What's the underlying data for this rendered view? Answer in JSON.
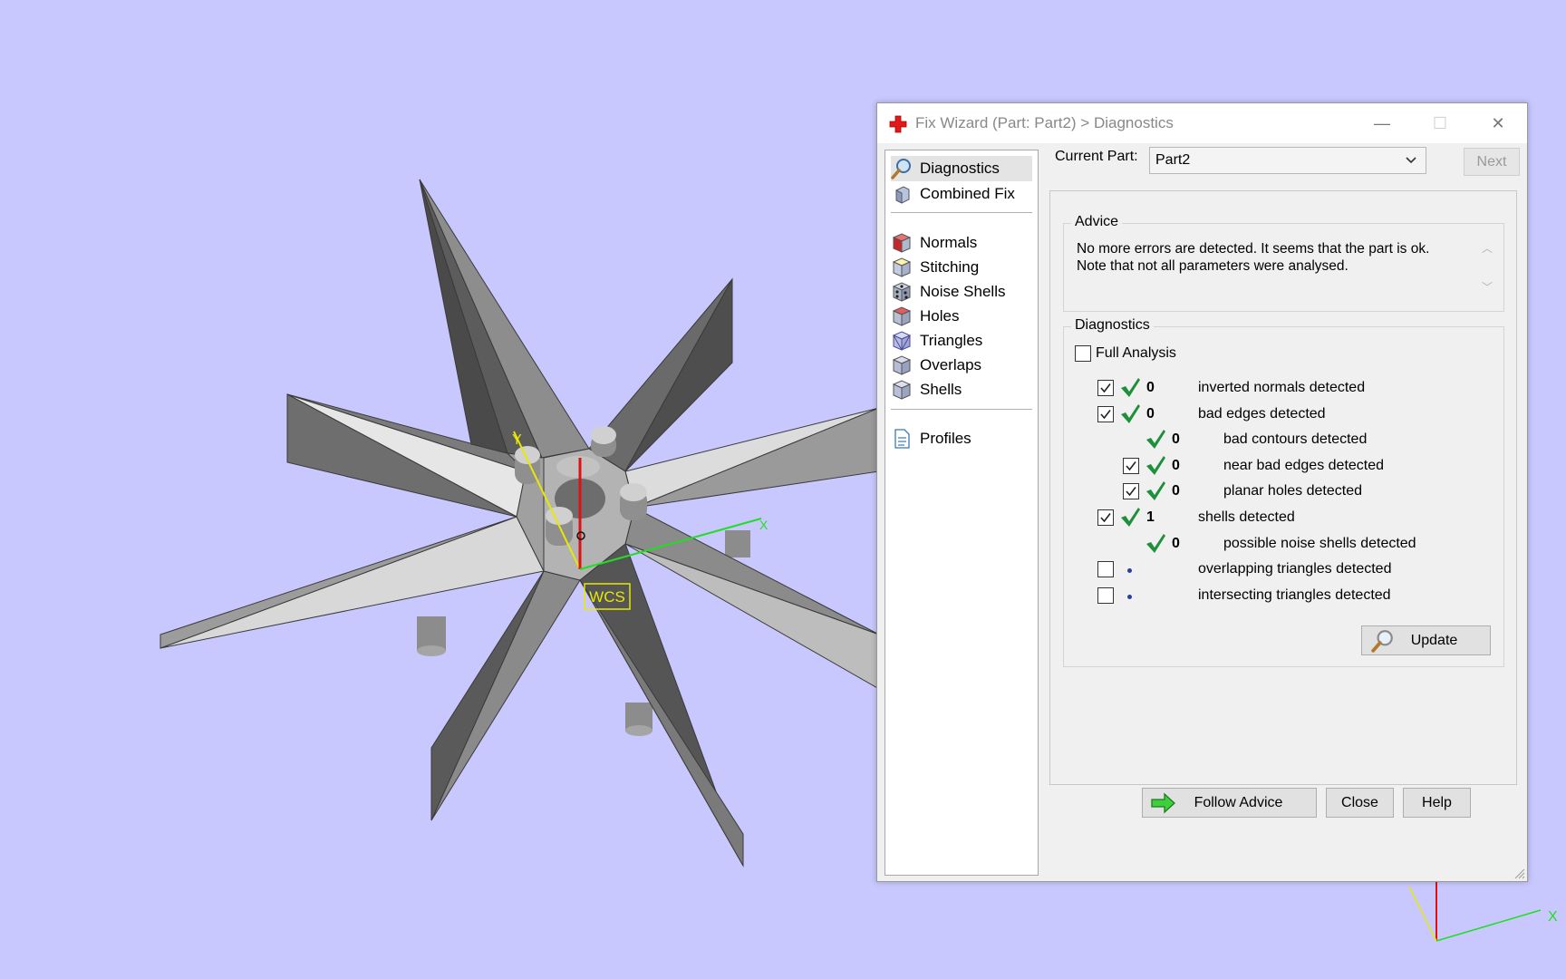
{
  "window": {
    "title": "Fix Wizard (Part: Part2) > Diagnostics",
    "minimize": "—",
    "maximize": "☐",
    "close": "✕"
  },
  "nav": {
    "items": [
      {
        "label": "Diagnostics",
        "icon": "magnifier-icon",
        "selected": true
      },
      {
        "label": "Combined Fix",
        "icon": "cubes-icon"
      },
      {
        "label": "Normals",
        "icon": "normals-cube-icon"
      },
      {
        "label": "Stitching",
        "icon": "stitching-cube-icon"
      },
      {
        "label": "Noise Shells",
        "icon": "noise-shells-icon"
      },
      {
        "label": "Holes",
        "icon": "holes-cube-icon"
      },
      {
        "label": "Triangles",
        "icon": "triangles-cube-icon"
      },
      {
        "label": "Overlaps",
        "icon": "overlaps-cube-icon"
      },
      {
        "label": "Shells",
        "icon": "shells-cube-icon"
      },
      {
        "label": "Profiles",
        "icon": "document-icon"
      }
    ]
  },
  "current_part": {
    "label": "Current Part:",
    "value": "Part2",
    "next_label": "Next"
  },
  "advice": {
    "title": "Advice",
    "line1": "No more errors are detected. It seems that the part is ok.",
    "line2": "Note that not all parameters were analysed."
  },
  "diagnostics": {
    "title": "Diagnostics",
    "full_analysis": {
      "label": "Full Analysis",
      "checked": false
    },
    "rows": [
      {
        "checkbox": true,
        "checked": true,
        "status": "ok",
        "count": "0",
        "label": "inverted normals detected",
        "indent": 0
      },
      {
        "checkbox": true,
        "checked": true,
        "status": "ok",
        "count": "0",
        "label": "bad edges detected",
        "indent": 0
      },
      {
        "checkbox": false,
        "status": "ok",
        "count": "0",
        "label": "bad contours detected",
        "indent": 1
      },
      {
        "checkbox": true,
        "checked": true,
        "status": "ok",
        "count": "0",
        "label": "near bad edges detected",
        "indent": 1
      },
      {
        "checkbox": true,
        "checked": true,
        "status": "ok",
        "count": "0",
        "label": "planar holes detected",
        "indent": 1
      },
      {
        "checkbox": true,
        "checked": true,
        "status": "ok",
        "count": "1",
        "label": "shells detected",
        "indent": 0
      },
      {
        "checkbox": false,
        "status": "ok",
        "count": "0",
        "label": "possible noise shells detected",
        "indent": 1
      },
      {
        "checkbox": true,
        "checked": false,
        "status": "pending",
        "count": "",
        "label": "overlapping triangles detected",
        "indent": 0
      },
      {
        "checkbox": true,
        "checked": false,
        "status": "pending",
        "count": "",
        "label": "intersecting triangles detected",
        "indent": 0
      }
    ],
    "update_label": "Update"
  },
  "footer": {
    "follow_advice": "Follow Advice",
    "close": "Close",
    "help": "Help"
  },
  "viewport": {
    "background": "#c8c8ff",
    "wcs_label": "WCS",
    "axis_x": "X",
    "axis_y": "Y",
    "axis_x_color": "#22dd22",
    "axis_y_color": "#e8e800",
    "axis_z_color": "#dd1111"
  }
}
